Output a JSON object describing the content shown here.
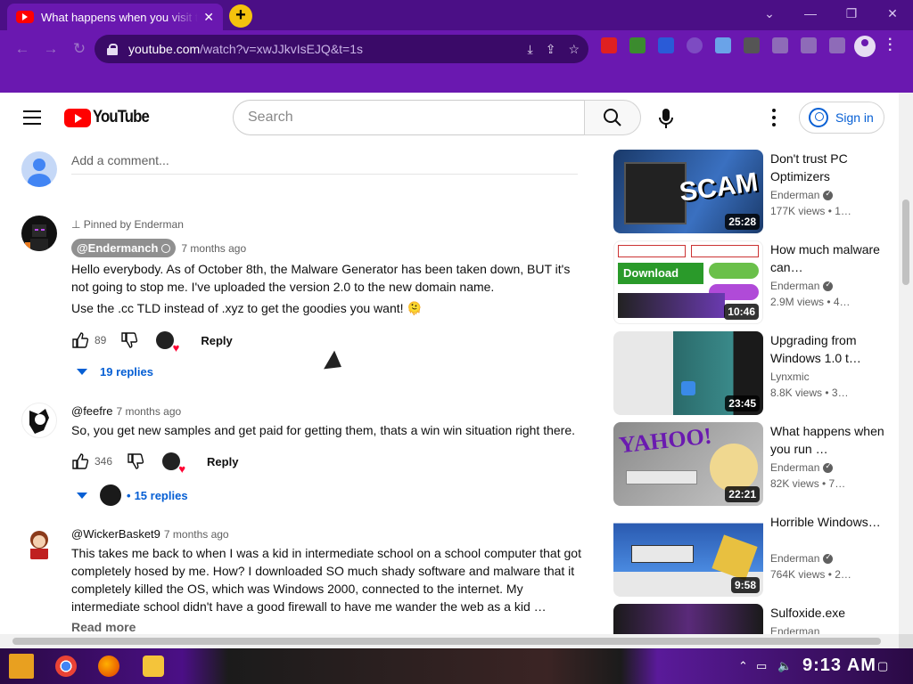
{
  "browser": {
    "tab_title": "What happens when you visit the",
    "url_host": "youtube.com",
    "url_path": "/watch?v=xwJJkvIsEJQ&t=1s"
  },
  "header": {
    "logo_text": "YouTube",
    "search_placeholder": "Search",
    "signin_label": "Sign in"
  },
  "comments": {
    "add_placeholder": "Add a comment...",
    "items": [
      {
        "pinned": "Pinned by Enderman",
        "handle": "@Endermanch",
        "time": "7 months ago",
        "body": "Hello everybody. As of October 8th, the Malware Generator has been taken down, BUT it's not going to stop me. I've uploaded the version 2.0 to the new domain name.",
        "body2": "Use the .cc TLD instead of .xyz to get the goodies you want! 🫠",
        "likes": "89",
        "reply": "Reply",
        "replies": "19 replies"
      },
      {
        "handle": "@feefre",
        "time": "7 months ago",
        "body": "So, you get new samples and get paid for getting them, thats a win win situation right there.",
        "likes": "346",
        "reply": "Reply",
        "replies": "15 replies"
      },
      {
        "handle": "@WickerBasket9",
        "time": "7 months ago",
        "body": "This takes me back to when I was a kid in intermediate school on a school computer that got completely hosed by me. How? I downloaded SO much shady software and malware that it completely killed the OS, which was Windows 2000, connected to the internet. My intermediate school didn't have a good firewall to have me wander the web as a kid …",
        "read_more": "Read more"
      }
    ]
  },
  "sidebar": [
    {
      "title": "Don't trust PC Optimizers",
      "channel": "Enderman",
      "meta": "177K views  • 1…",
      "duration": "25:28",
      "thumb_text": "SCAM"
    },
    {
      "title": "How much malware can…",
      "channel": "Enderman",
      "meta": "2.9M views  • 4…",
      "duration": "10:46",
      "thumb_text": "Download"
    },
    {
      "title": "Upgrading from Windows 1.0 t…",
      "channel": "Lynxmic",
      "meta": "8.8K views  • 3…",
      "duration": "23:45",
      "thumb_text": ""
    },
    {
      "title": "What happens when you run …",
      "channel": "Enderman",
      "meta": "82K views  • 7…",
      "duration": "22:21",
      "thumb_text": "YAHOO!"
    },
    {
      "title": "Horrible Windows…",
      "channel": "Enderman",
      "meta": "764K views  • 2…",
      "duration": "9:58",
      "thumb_text": ""
    },
    {
      "title": "Sulfoxide.exe",
      "channel": "Enderman",
      "meta": "",
      "duration": "",
      "thumb_text": ""
    }
  ],
  "taskbar": {
    "clock": "9:13 AM"
  },
  "colors": {
    "chrome_frame": "#6a18b0",
    "yt_red": "#ff0000",
    "link_blue": "#065fd4"
  }
}
